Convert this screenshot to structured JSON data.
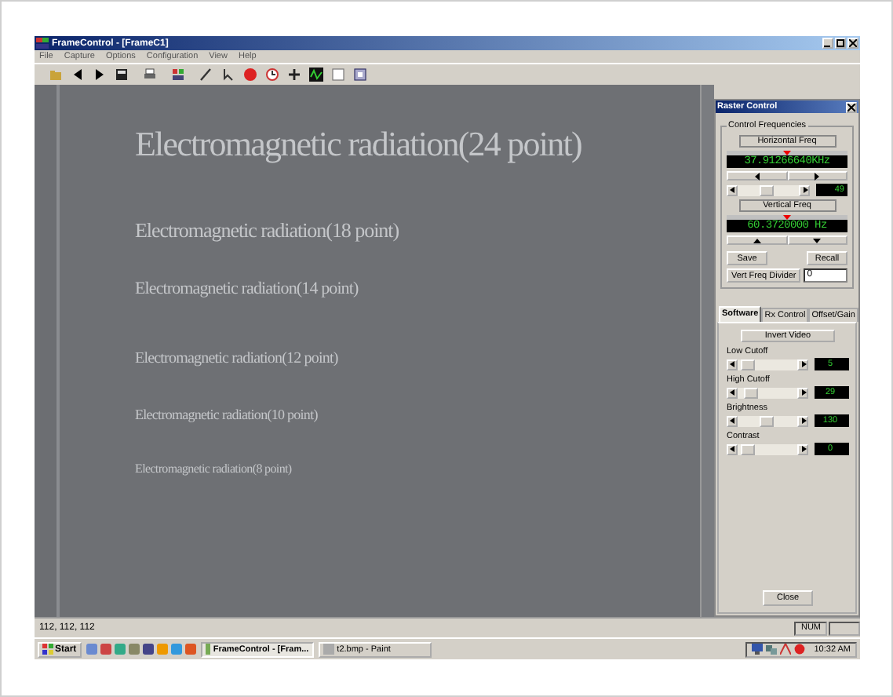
{
  "window": {
    "title": "FrameControl - [FrameC1]"
  },
  "menu": [
    "File",
    "Capture",
    "Options",
    "Configuration",
    "View",
    "Help"
  ],
  "canvas": {
    "lines": [
      "Electromagnetic radiation(24 point)",
      "Electromagnetic radiation(18 point)",
      "Electromagnetic radiation(14 point)",
      "Electromagnetic radiation(12 point)",
      "Electromagnetic radiation(10 point)",
      "Electromagnetic radiation(8 point)"
    ]
  },
  "raster_control": {
    "title": "Raster Control",
    "group_title": "Control Frequencies",
    "horizontal": {
      "label": "Horizontal Freq",
      "display": "37.91266640KHz",
      "reading": "49"
    },
    "vertical": {
      "label": "Vertical Freq",
      "display": "60.3720000 Hz"
    },
    "buttons": [
      "Save",
      "Recall"
    ],
    "divider": {
      "label": "Vert Freq Divider",
      "value": "0"
    },
    "tabs": [
      {
        "label": "Software",
        "selected": true
      },
      {
        "label": "Rx Control",
        "selected": false
      },
      {
        "label": "Offset/Gain",
        "selected": false
      }
    ],
    "invert_button": "Invert Video",
    "sliders": [
      {
        "label": "Low Cutoff",
        "reading": "5"
      },
      {
        "label": "High Cutoff",
        "reading": "29"
      },
      {
        "label": "Brightness",
        "reading": "130"
      },
      {
        "label": "Contrast",
        "reading": "0"
      }
    ],
    "close_button": "Close"
  },
  "status_bar": {
    "text": "112, 112, 112",
    "indicator": "NUM"
  },
  "taskbar": {
    "start": "Start",
    "tasks": [
      {
        "label": "FrameControl - [Fram...",
        "selected": true
      },
      {
        "label": "t2.bmp - Paint",
        "selected": false
      }
    ],
    "clock": "10:32 AM"
  }
}
